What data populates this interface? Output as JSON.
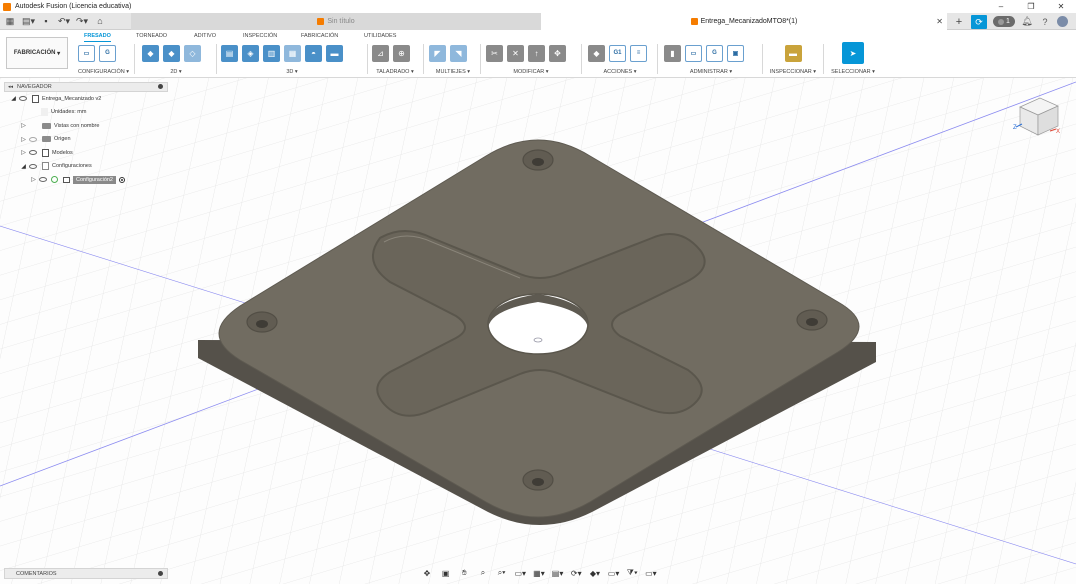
{
  "window": {
    "title": "Autodesk Fusion (Licencia educativa)"
  },
  "tabs": [
    {
      "label": "Sin título",
      "active": false
    },
    {
      "label": "Entrega_MecanizadoMTO8*(1)",
      "active": true
    }
  ],
  "header": {
    "jobs_count": "1"
  },
  "ribbon": {
    "workspace": "FABRICACIÓN",
    "tabs": [
      "FRESADO",
      "TORNEADO",
      "ADITIVO",
      "INSPECCIÓN",
      "FABRICACIÓN",
      "UTILIDADES"
    ],
    "active_tab": "FRESADO",
    "groups": {
      "configuracion": "CONFIGURACIÓN",
      "2d": "2D",
      "3d": "3D",
      "taladrado": "TALADRADO",
      "multiejes": "MULTIEJES",
      "modificar": "MODIFICAR",
      "acciones": "ACCIONES",
      "administrar": "ADMINISTRAR",
      "inspeccionar": "INSPECCIONAR",
      "seleccionar": "SELECCIONAR"
    }
  },
  "navigator": {
    "title": "NAVEGADOR",
    "root": "Entrega_Mecanizado v2",
    "units": "Unidades: mm",
    "items": {
      "named_views": "Vistas con nombre",
      "origin": "Origen",
      "models": "Modelos",
      "setups": "Configuraciones",
      "setup": "Configuración2"
    }
  },
  "comments": {
    "title": "COMENTARIOS"
  },
  "colors": {
    "accent": "#0696d7",
    "part": "#6f6a5e",
    "part_edge": "#5a564c"
  },
  "icons": [
    "grid-icon",
    "file-icon",
    "undo-icon",
    "redo-icon",
    "home-icon",
    "close-icon",
    "plus-icon",
    "sync-icon",
    "bell-icon",
    "help-icon",
    "avatar-icon",
    "pin-icon",
    "eye-icon",
    "folder-icon",
    "orbit-icon",
    "pan-icon",
    "zoom-icon",
    "viewcube-icon"
  ]
}
